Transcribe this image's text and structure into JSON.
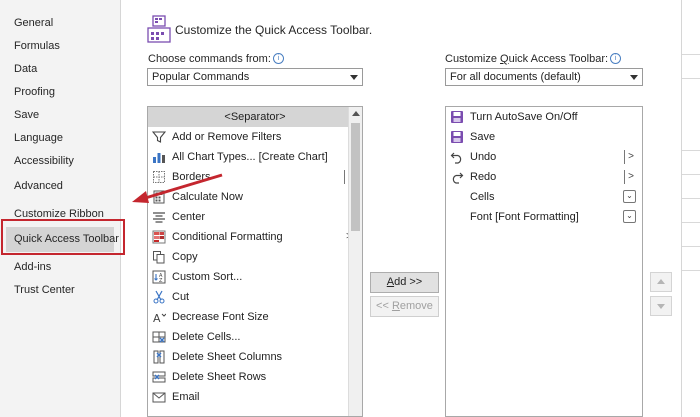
{
  "sidebar": {
    "items": [
      {
        "label": "General"
      },
      {
        "label": "Formulas"
      },
      {
        "label": "Data"
      },
      {
        "label": "Proofing"
      },
      {
        "label": "Save"
      },
      {
        "label": "Language"
      },
      {
        "label": "Accessibility"
      },
      {
        "label": "Advanced"
      },
      {
        "label": "Customize Ribbon"
      },
      {
        "label": "Quick Access Toolbar"
      },
      {
        "label": "Add-ins"
      },
      {
        "label": "Trust Center"
      }
    ],
    "selected": "Quick Access Toolbar"
  },
  "header": {
    "title": "Customize the Quick Access Toolbar."
  },
  "commands_from": {
    "label_pre": "Choose commands from:",
    "value": "Popular Commands"
  },
  "qat_target": {
    "label_pre": "Customize ",
    "label_u": "Q",
    "label_post": "uick Access Toolbar:",
    "value": "For all documents (default)"
  },
  "commands_list": [
    {
      "label": "<Separator>",
      "icon": "separator"
    },
    {
      "label": "Add or Remove Filters",
      "icon": "filter-icon"
    },
    {
      "label": "All Chart Types... [Create Chart]",
      "icon": "chart-icon"
    },
    {
      "label": "Borders",
      "icon": "borders-icon"
    },
    {
      "label": "Calculate Now",
      "icon": "calculator-icon"
    },
    {
      "label": "Center",
      "icon": "center-align-icon"
    },
    {
      "label": "Conditional Formatting",
      "icon": "conditional-formatting-icon"
    },
    {
      "label": "Copy",
      "icon": "copy-icon"
    },
    {
      "label": "Custom Sort...",
      "icon": "sort-icon"
    },
    {
      "label": "Cut",
      "icon": "scissors-icon"
    },
    {
      "label": "Decrease Font Size",
      "icon": "decrease-font-icon"
    },
    {
      "label": "Delete Cells...",
      "icon": "delete-cells-icon"
    },
    {
      "label": "Delete Sheet Columns",
      "icon": "delete-columns-icon"
    },
    {
      "label": "Delete Sheet Rows",
      "icon": "delete-rows-icon"
    },
    {
      "label": "Email",
      "icon": "email-icon"
    }
  ],
  "qat_list": [
    {
      "label": "Turn AutoSave On/Off",
      "icon": "autosave-icon"
    },
    {
      "label": "Save",
      "icon": "save-icon"
    },
    {
      "label": "Undo",
      "icon": "undo-icon"
    },
    {
      "label": "Redo",
      "icon": "redo-icon"
    },
    {
      "label": "Cells",
      "icon": ""
    },
    {
      "label": "Font [Font Formatting]",
      "icon": ""
    }
  ],
  "buttons": {
    "add_u": "A",
    "add_rest": "dd >>",
    "remove_pre": "<< ",
    "remove_u": "R",
    "remove_rest": "emove"
  },
  "colors": {
    "accent": "#7b4db0",
    "annotation": "#c4262e"
  }
}
